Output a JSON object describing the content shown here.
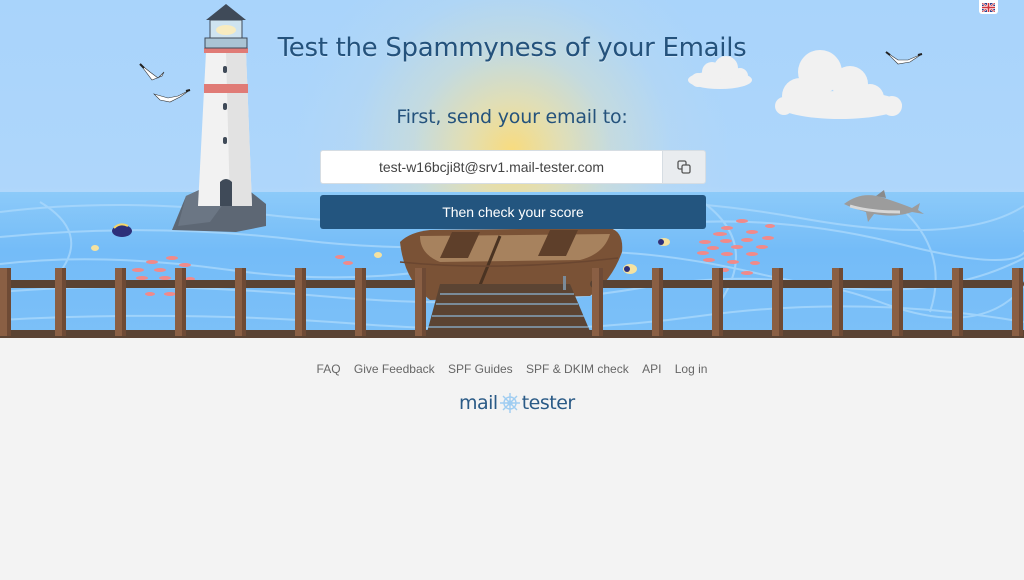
{
  "hero": {
    "title": "Test the Spammyness of your Emails",
    "subtitle": "First, send your email to:",
    "email_address": "test-w16bcji8t@srv1.mail-tester.com",
    "copy_icon": "copy-icon",
    "check_button_label": "Then check your score"
  },
  "language": {
    "current": "English",
    "icon": "uk-flag-icon"
  },
  "footer": {
    "links": [
      {
        "label": "FAQ"
      },
      {
        "label": "Give Feedback"
      },
      {
        "label": "SPF Guides"
      },
      {
        "label": "SPF & DKIM check"
      },
      {
        "label": "API"
      },
      {
        "label": "Log in"
      }
    ],
    "logo": {
      "left": "mail",
      "right": "tester",
      "icon": "ship-wheel-icon"
    }
  },
  "colors": {
    "brand": "#23557f",
    "title": "#24527c",
    "sky": "#aed6fb",
    "sea": "#74bcf8",
    "footer_bg": "#f3f3f3"
  }
}
